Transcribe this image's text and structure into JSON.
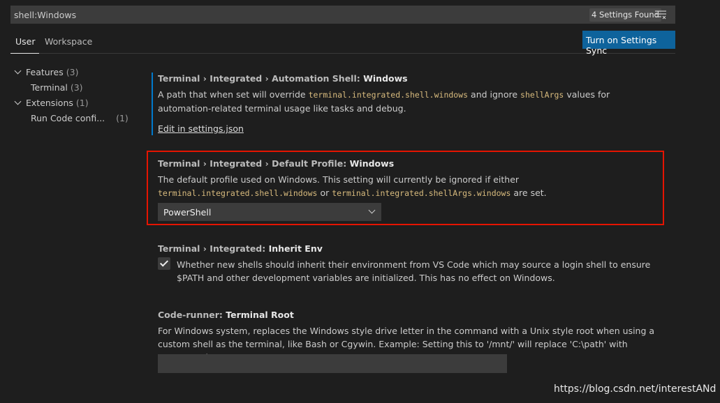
{
  "search": {
    "value": "shell:Windows",
    "count": "4 Settings Found"
  },
  "tabs": [
    "User",
    "Workspace"
  ],
  "sync_button": "Turn on Settings Sync",
  "toc": [
    {
      "label": "Features",
      "count": "(3)"
    },
    {
      "label": "Terminal",
      "count": "(3)"
    },
    {
      "label": "Extensions",
      "count": "(1)"
    },
    {
      "label": "Run Code confi...",
      "count": "(1)"
    }
  ],
  "settings": [
    {
      "prefix": "Terminal › Integrated › Automation Shell: ",
      "name": "Windows",
      "d1": "A path that when set will override ",
      "c1": "terminal.integrated.shell.windows",
      "d2": " and ignore ",
      "c2": "shellArgs",
      "d3": " values for automation-related terminal usage like tasks and debug.",
      "link": "Edit in settings.json"
    },
    {
      "prefix": "Terminal › Integrated › Default Profile: ",
      "name": "Windows",
      "d1": "The default profile used on Windows. This setting will currently be ignored if either ",
      "c1": "terminal.integrated.shell.windows",
      "d2": " or ",
      "c2": "terminal.integrated.shellArgs.windows",
      "d3": " are set.",
      "value": "PowerShell"
    },
    {
      "prefix": "Terminal › Integrated: ",
      "name": "Inherit Env",
      "desc": "Whether new shells should inherit their environment from VS Code which may source a login shell to ensure $PATH and other development variables are initialized. This has no effect on Windows.",
      "checked": true
    },
    {
      "prefix": "Code-runner: ",
      "name": "Terminal Root",
      "desc": "For Windows system, replaces the Windows style drive letter in the command with a Unix style root when using a custom shell as the terminal, like Bash or Cgywin. Example: Setting this to '/mnt/' will replace 'C:\\path' with '/mnt/c/path'",
      "value": ""
    }
  ],
  "watermark": "https://blog.csdn.net/interestANd",
  "colors": {
    "accent": "#007acc",
    "button": "#0e639c",
    "highlight_border": "#e51400",
    "code": "#d7ba7d"
  }
}
